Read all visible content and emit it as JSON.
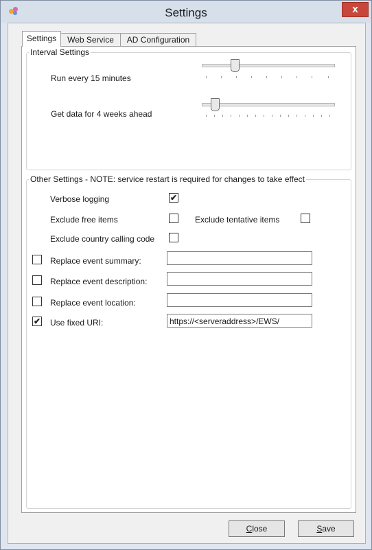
{
  "window": {
    "title": "Settings",
    "close_glyph": "x"
  },
  "tabs": [
    {
      "label": "Settings",
      "active": true
    },
    {
      "label": "Web Service",
      "active": false
    },
    {
      "label": "AD Configuration",
      "active": false
    }
  ],
  "interval": {
    "caption": "Interval Settings",
    "run_label": "Run every 15 minutes",
    "run_value": 15,
    "data_label": "Get data for 4 weeks ahead",
    "data_value": 4
  },
  "other": {
    "caption": "Other Settings - NOTE: service restart is required for changes to take effect",
    "verbose_label": "Verbose logging",
    "verbose_checked": true,
    "exclude_free_label": "Exclude free items",
    "exclude_free_checked": false,
    "exclude_tentative_label": "Exclude tentative items",
    "exclude_tentative_checked": false,
    "exclude_country_label": "Exclude country calling code",
    "exclude_country_checked": false,
    "replace_summary_label": "Replace event summary:",
    "replace_summary_checked": false,
    "replace_summary_value": "",
    "replace_description_label": "Replace event description:",
    "replace_description_checked": false,
    "replace_description_value": "",
    "replace_location_label": "Replace event location:",
    "replace_location_checked": false,
    "replace_location_value": "",
    "fixed_uri_label": "Use fixed URI:",
    "fixed_uri_checked": true,
    "fixed_uri_value": "https://<serveraddress>/EWS/"
  },
  "buttons": {
    "close_mnemonic": "C",
    "close_rest": "lose",
    "save_mnemonic": "S",
    "save_rest": "ave"
  },
  "check_glyph": "✔"
}
